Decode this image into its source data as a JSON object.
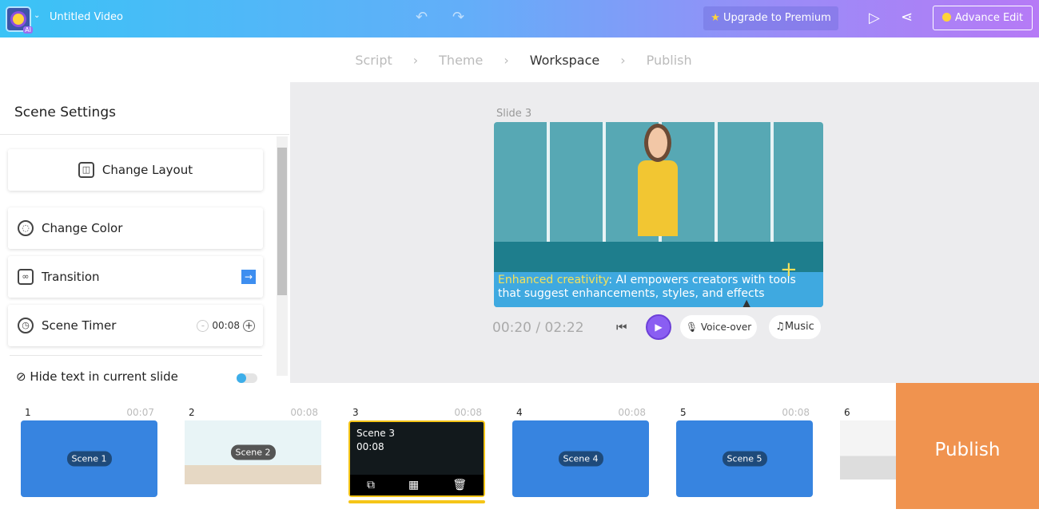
{
  "header": {
    "title": "Untitled Video",
    "logo_badge": "AI",
    "upgrade_label": "Upgrade to Premium",
    "advance_edit_label": "Advance Edit"
  },
  "steps": [
    {
      "label": "Script"
    },
    {
      "label": "Theme"
    },
    {
      "label": "Workspace",
      "active": true
    },
    {
      "label": "Publish"
    }
  ],
  "sidebar": {
    "title": "Scene Settings",
    "items": [
      {
        "label": "Change Layout"
      },
      {
        "label": "Change Color"
      },
      {
        "label": "Transition"
      },
      {
        "label": "Scene Timer",
        "value": "00:08"
      },
      {
        "label": "Hide text in current slide"
      }
    ]
  },
  "preview": {
    "slide_label": "Slide 3",
    "caption_highlight": "Enhanced creativity",
    "caption_text": ": AI empowers creators with tools that suggest enhancements, styles, and effects",
    "time": "00:20 / 02:22",
    "voiceover_label": "Voice-over",
    "music_label": "Music"
  },
  "scenes": [
    {
      "num": "1",
      "duration": "00:07",
      "label": "Scene 1"
    },
    {
      "num": "2",
      "duration": "00:08",
      "label": "Scene 2"
    },
    {
      "num": "3",
      "duration": "00:08",
      "label": "Scene 3",
      "selected": true
    },
    {
      "num": "4",
      "duration": "00:08",
      "label": "Scene 4"
    },
    {
      "num": "5",
      "duration": "00:08",
      "label": "Scene 5"
    },
    {
      "num": "6",
      "duration": "",
      "label": ""
    }
  ],
  "publish_label": "Publish",
  "colors": {
    "accent": "#8a5ef2",
    "publish": "#f0934f",
    "selected": "#f5c518",
    "scene": "#3784e0"
  }
}
